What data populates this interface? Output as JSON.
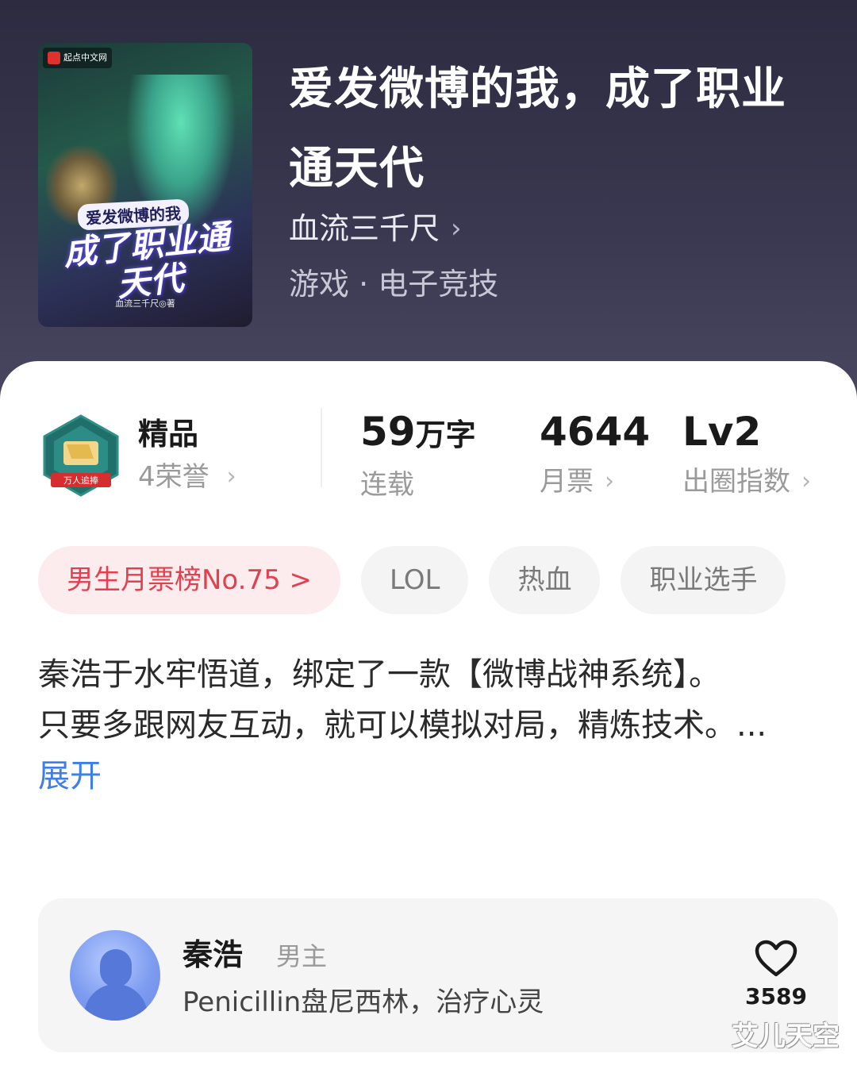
{
  "book": {
    "title": "爱发微博的我，成了职业通天代",
    "author": "血流三千尺",
    "genre": "游戏 · 电子竞技"
  },
  "cover": {
    "publisher": "起点中文网",
    "subtitle": "爱发微博的我",
    "main_title": "成了职业通天代",
    "author_line": "血流三千尺◎著"
  },
  "stats": {
    "quality": {
      "label": "精品",
      "honors": "4荣誉",
      "badge_text": "万人追捧"
    },
    "words": {
      "value": "59",
      "unit": "万字",
      "label": "连载"
    },
    "votes": {
      "value": "4644",
      "label": "月票"
    },
    "index": {
      "value": "Lv2",
      "label": "出圈指数"
    }
  },
  "tags": [
    {
      "label": "男生月票榜No.75 >"
    },
    {
      "label": "LOL"
    },
    {
      "label": "热血"
    },
    {
      "label": "职业选手"
    }
  ],
  "description": {
    "line1": "秦浩于水牢悟道，绑定了一款【微博战神系统】。",
    "line2": "只要多跟网友互动，就可以模拟对局，精炼技术。...",
    "expand": "展开"
  },
  "character": {
    "name": "秦浩",
    "role": "男主",
    "desc": "Penicillin盘尼西林，治疗心灵",
    "likes": "3589"
  },
  "watermark": "艾儿天空",
  "colors": {
    "accent_link": "#3e7ee8",
    "rank_tag_text": "#e2404f",
    "rank_tag_bg": "#fdecee"
  }
}
